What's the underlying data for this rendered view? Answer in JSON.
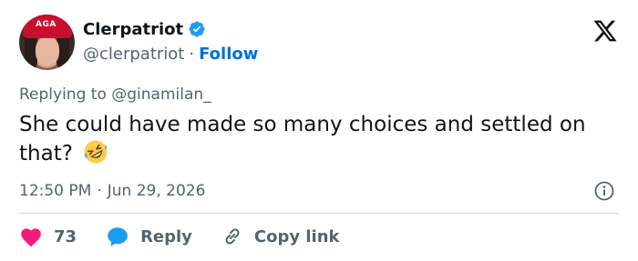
{
  "author": {
    "display_name": "Clerpatriot",
    "handle": "@clerpatriot",
    "separator": "·",
    "follow_label": "Follow",
    "avatar_cap_text": "AGA"
  },
  "tweet": {
    "replying_prefix": "Replying to",
    "replying_to": "@ginamilan_",
    "text": "She could have made so many choices and settled on that?",
    "emoji": "rolling-on-floor-laughing"
  },
  "meta": {
    "time": "12:50 PM",
    "separator": "·",
    "date": "Jun 29, 2026"
  },
  "actions": {
    "like_count": "73",
    "reply_label": "Reply",
    "copy_label": "Copy link"
  },
  "colors": {
    "accent": "#1d9bf0",
    "follow": "#006fd6",
    "like": "#f91880",
    "muted": "#536471",
    "text": "#0f1419",
    "divider": "#cfd9de"
  }
}
